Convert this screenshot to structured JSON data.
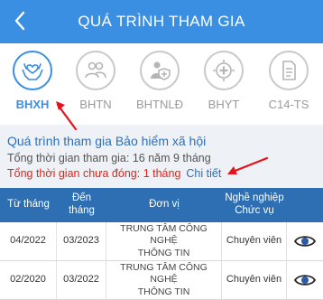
{
  "header": {
    "title": "QUÁ TRÌNH THAM GIA"
  },
  "tabs": [
    {
      "label": "BHXH",
      "icon": "hands-heart-icon",
      "active": true
    },
    {
      "label": "BHTN",
      "icon": "people-icon",
      "active": false
    },
    {
      "label": "BHTNLĐ",
      "icon": "worker-shield-icon",
      "active": false
    },
    {
      "label": "BHYT",
      "icon": "medical-cross-icon",
      "active": false
    },
    {
      "label": "C14-TS",
      "icon": "document-icon",
      "active": false
    }
  ],
  "summary": {
    "title": "Quá trình tham gia Bảo hiểm xã hội",
    "total_participation": "Tổng thời gian tham gia: 16 năm 9 tháng",
    "total_unpaid": "Tổng thời gian chưa đóng: 1 tháng",
    "detail_link": "Chi tiết"
  },
  "table": {
    "headers": {
      "from_month": "Từ tháng",
      "to_month_line1": "Đến",
      "to_month_line2": "tháng",
      "unit": "Đơn vị",
      "job_line1": "Nghề nghiệp",
      "job_line2": "Chức vụ"
    },
    "rows": [
      {
        "from": "04/2022",
        "to": "03/2023",
        "unit_line1": "TRUNG TÂM CÔNG NGHỆ",
        "unit_line2": "THÔNG TIN",
        "position": "Chuyên viên"
      },
      {
        "from": "02/2020",
        "to": "03/2022",
        "unit_line1": "TRUNG TÂM CÔNG NGHỆ",
        "unit_line2": "THÔNG TIN",
        "position": "Chuyên viên"
      }
    ]
  },
  "colors": {
    "primary": "#3a8fe3",
    "table_header": "#2d6fb2",
    "summary_bg": "#eef1f5",
    "alert_red": "#e0251b",
    "annotation_arrow": "#e3141b"
  }
}
